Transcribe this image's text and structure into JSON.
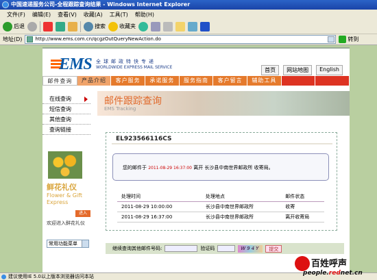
{
  "window": {
    "title": "中国速递服务公司-全程跟踪查询结果 - Windows Internet Explorer"
  },
  "menu": [
    "文件(F)",
    "编辑(E)",
    "查看(V)",
    "收藏(A)",
    "工具(T)",
    "帮助(H)"
  ],
  "toolbar": {
    "back": "后退",
    "search": "搜索",
    "favorites": "收藏夹"
  },
  "address": {
    "label": "地址(D)",
    "url": "http://www.ems.com.cn/qcgzOutQueryNewAction.do",
    "go": "转到"
  },
  "site": {
    "logo_text": "EMS",
    "logo_cn": "全球邮政特快专递",
    "logo_en": "WORLDWIDE EXPRESS MAIL SERVICE",
    "top_links": [
      "首页",
      "网站地图",
      "English"
    ],
    "nav": [
      "邮件查询",
      "产品介绍",
      "客户服务",
      "承诺服务",
      "服务指南",
      "客户留言",
      "辅助工具",
      "",
      ""
    ],
    "sidebar": [
      "在线查询",
      "短信查询",
      "其他查询",
      "查询链接"
    ],
    "banner_title": "邮件跟踪查询",
    "banner_sub": "EMS Tracking",
    "flower": {
      "cn": "鲜花礼仪",
      "en": "Flower & Gift Express",
      "enter": "进入",
      "link": "欢迎进入鲜花礼仪"
    },
    "select_label": "常用功能菜单",
    "tracking_no": "EL923566116CS",
    "status": {
      "prefix": "您的邮件于",
      "datetime": "2011-08-29 16:37:00",
      "suffix": "离开 长沙县中南世界邮政所 收寄局。"
    },
    "table": {
      "headers": [
        "处理时间",
        "处理地点",
        "邮件状态"
      ],
      "rows": [
        [
          "2011-08-29   10:00:00",
          "长沙县中南世界邮政所",
          "收寄"
        ],
        [
          "2011-08-29   16:37:00",
          "长沙县中南世界邮政所",
          "离开收寄局"
        ]
      ]
    },
    "bottom": {
      "query_label": "继续查询其他邮件号码:",
      "captcha_label": "验证码",
      "captcha": "W94Y",
      "submit": "提交"
    }
  },
  "statusbar": {
    "text": "建议使用IE 5.0以上版本浏览器访问本站"
  },
  "watermark": {
    "cn": "百姓呼声",
    "url_a": "people.",
    "url_b": "red",
    "url_c": "net.cn"
  },
  "colors": {
    "ems_blue": "#0a5aa8",
    "nav_orange": "#e57a2c",
    "status_red": "#cc0000"
  }
}
